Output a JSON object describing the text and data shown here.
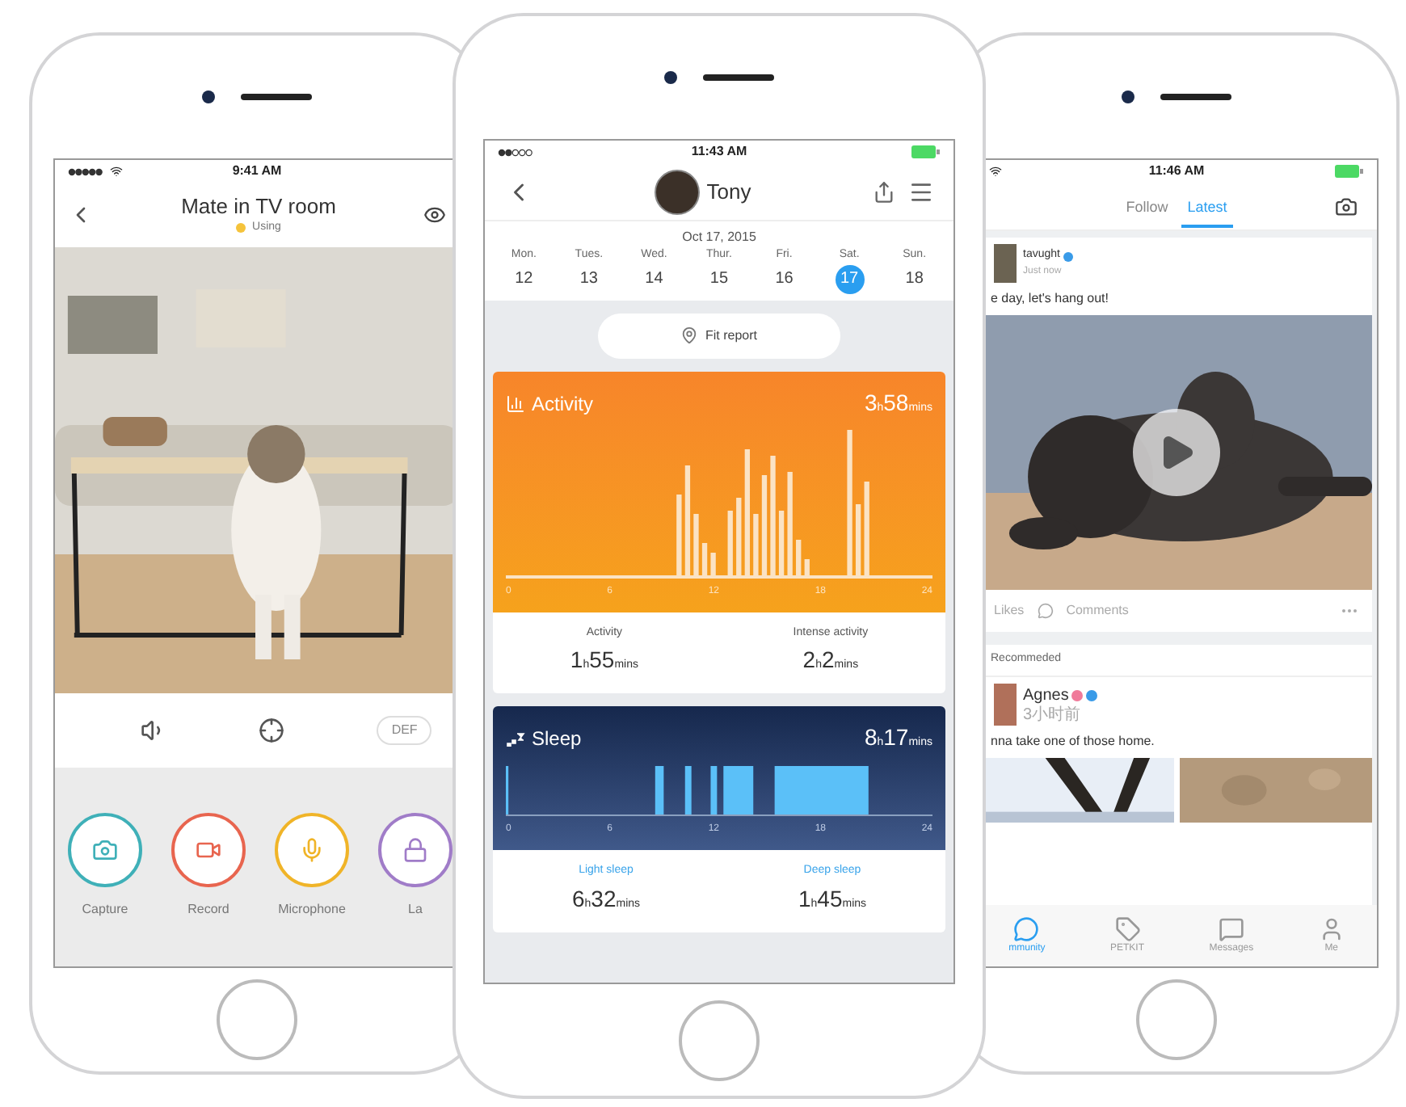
{
  "phones": [
    {
      "kind": "camera",
      "status_bar": {
        "time": "9:41 AM"
      },
      "header": {
        "title": "Mate in TV room",
        "subtitle": "Using"
      },
      "controls": {
        "quality": "DEF"
      },
      "actions": [
        {
          "label": "Capture",
          "color": "#3fb0b8"
        },
        {
          "label": "Record",
          "color": "#e8654f"
        },
        {
          "label": "Microphone",
          "color": "#f0b428"
        },
        {
          "label": "La",
          "color": "#a07cc8"
        }
      ]
    },
    {
      "kind": "fitness",
      "status_bar": {
        "time": "11:43 AM"
      },
      "header": {
        "name": "Tony"
      },
      "date": "Oct 17, 2015",
      "week": [
        {
          "day": "Mon.",
          "date": "12",
          "selected": false
        },
        {
          "day": "Tues.",
          "date": "13",
          "selected": false
        },
        {
          "day": "Wed.",
          "date": "14",
          "selected": false
        },
        {
          "day": "Thur.",
          "date": "15",
          "selected": false
        },
        {
          "day": "Fri.",
          "date": "16",
          "selected": false
        },
        {
          "day": "Sat.",
          "date": "17",
          "selected": true
        },
        {
          "day": "Sun.",
          "date": "18",
          "selected": false
        }
      ],
      "report_button": "Fit report",
      "cards": [
        {
          "kind": "activity",
          "title": "Activity",
          "total": [
            {
              "n": "3",
              "unit": "h"
            },
            {
              "n": "58",
              "unit": "mins"
            }
          ],
          "axis": [
            "0",
            "6",
            "12",
            "18",
            "24"
          ],
          "stats": [
            {
              "label": "Activity",
              "value": [
                {
                  "n": "1",
                  "unit": "h"
                },
                {
                  "n": "55",
                  "unit": "mins"
                }
              ]
            },
            {
              "label": "Intense activity",
              "value": [
                {
                  "n": "2",
                  "unit": "h"
                },
                {
                  "n": "2",
                  "unit": "mins"
                }
              ]
            }
          ]
        },
        {
          "kind": "sleep",
          "title": "Sleep",
          "total": [
            {
              "n": "8",
              "unit": "h"
            },
            {
              "n": "17",
              "unit": "mins"
            }
          ],
          "axis": [
            "0",
            "6",
            "12",
            "18",
            "24"
          ],
          "stats": [
            {
              "label": "Light sleep",
              "value": [
                {
                  "n": "6",
                  "unit": "h"
                },
                {
                  "n": "32",
                  "unit": "mins"
                }
              ]
            },
            {
              "label": "Deep sleep",
              "value": [
                {
                  "n": "1",
                  "unit": "h"
                },
                {
                  "n": "45",
                  "unit": "mins"
                }
              ]
            }
          ]
        }
      ]
    },
    {
      "kind": "social",
      "status_bar": {
        "time": "11:46 AM"
      },
      "tabs": [
        {
          "label": "Follow",
          "selected": false
        },
        {
          "label": "Latest",
          "selected": true
        }
      ],
      "post": {
        "author": "tavught",
        "time": "Just now",
        "text": "e day, let's hang out!",
        "actions": [
          "Likes",
          "Comments"
        ]
      },
      "section": "Recommeded",
      "post2": {
        "author": "Agnes",
        "time": "3小时前",
        "text": "nna take one of those home."
      },
      "nav": [
        {
          "label": "mmunity",
          "selected": true
        },
        {
          "label": "PETKIT",
          "selected": false
        },
        {
          "label": "Messages",
          "selected": false
        },
        {
          "label": "Me",
          "selected": false
        }
      ]
    }
  ]
}
